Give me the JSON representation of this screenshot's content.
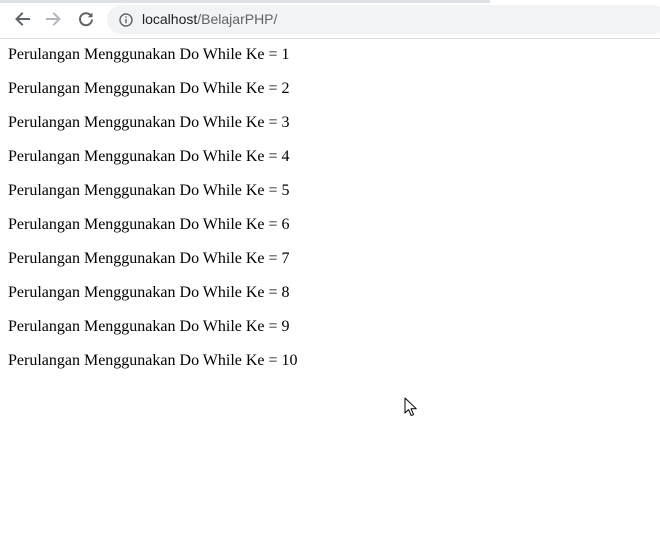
{
  "browser": {
    "url_host": "localhost",
    "url_path": "/BelajarPHP/",
    "icons": {
      "back": "arrow-left-icon",
      "forward": "arrow-right-icon",
      "reload": "reload-icon",
      "site_info": "info-icon"
    }
  },
  "page": {
    "lines": [
      "Perulangan Menggunakan Do While Ke = 1",
      "Perulangan Menggunakan Do While Ke = 2",
      "Perulangan Menggunakan Do While Ke = 3",
      "Perulangan Menggunakan Do While Ke = 4",
      "Perulangan Menggunakan Do While Ke = 5",
      "Perulangan Menggunakan Do While Ke = 6",
      "Perulangan Menggunakan Do While Ke = 7",
      "Perulangan Menggunakan Do While Ke = 8",
      "Perulangan Menggunakan Do While Ke = 9",
      "Perulangan Menggunakan Do While Ke = 10"
    ]
  }
}
